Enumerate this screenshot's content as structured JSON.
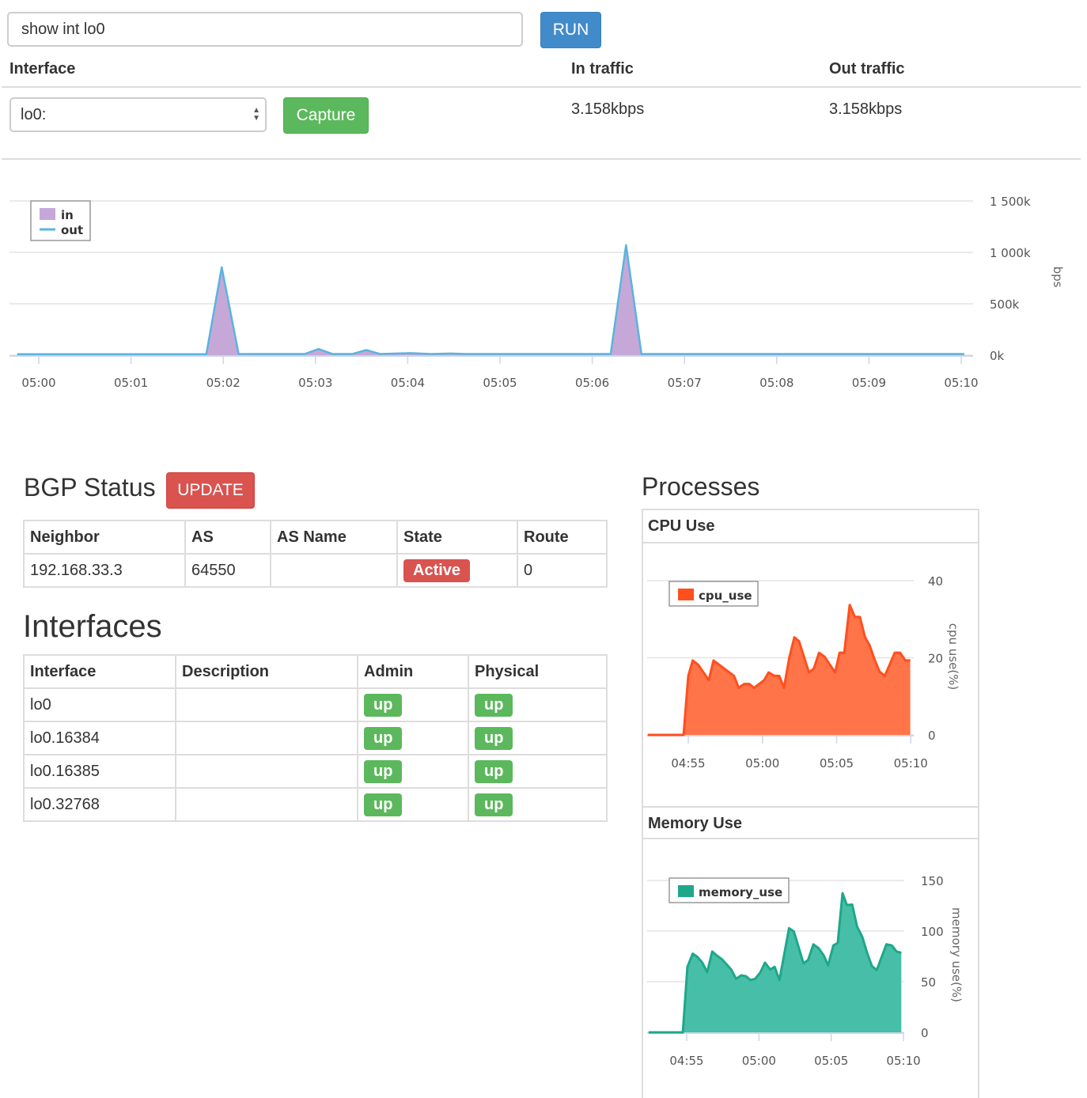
{
  "command": {
    "value": "show int lo0",
    "run_label": "RUN"
  },
  "traffic_table": {
    "headers": [
      "Interface",
      "In traffic",
      "Out traffic"
    ],
    "selected_interface": "lo0:",
    "capture_label": "Capture",
    "in_traffic": "3.158kbps",
    "out_traffic": "3.158kbps"
  },
  "bgp": {
    "title": "BGP Status",
    "update_label": "UPDATE",
    "headers": [
      "Neighbor",
      "AS",
      "AS Name",
      "State",
      "Route"
    ],
    "rows": [
      {
        "neighbor": "192.168.33.3",
        "as": "64550",
        "as_name": "",
        "state": "Active",
        "route": "0"
      }
    ]
  },
  "interfaces": {
    "title": "Interfaces",
    "headers": [
      "Interface",
      "Description",
      "Admin",
      "Physical"
    ],
    "rows": [
      {
        "name": "lo0",
        "description": "",
        "admin": "up",
        "physical": "up"
      },
      {
        "name": "lo0.16384",
        "description": "",
        "admin": "up",
        "physical": "up"
      },
      {
        "name": "lo0.16385",
        "description": "",
        "admin": "up",
        "physical": "up"
      },
      {
        "name": "lo0.32768",
        "description": "",
        "admin": "up",
        "physical": "up"
      }
    ]
  },
  "processes": {
    "title": "Processes",
    "cpu_title": "CPU Use",
    "memory_title": "Memory Use"
  },
  "colors": {
    "in": "#c5a8d8",
    "out": "#5ab4dc",
    "cpu": "#ff4f1f",
    "cpu_fill": "#ff7448",
    "memory": "#1fa78a",
    "memory_fill": "#47bfa8",
    "run": "#428bca",
    "capture": "#5cb85c",
    "danger": "#d9534f"
  },
  "chart_data": [
    {
      "type": "area",
      "ylabel": "bps",
      "ylim": [
        0,
        1500
      ],
      "yticks": [
        "0k",
        "500k",
        "1 000k",
        "1 500k"
      ],
      "yvalues": [
        0,
        500,
        1000,
        1500
      ],
      "xticks": [
        "05:00",
        "05:01",
        "05:02",
        "05:03",
        "05:04",
        "05:05",
        "05:06",
        "05:07",
        "05:08",
        "05:09",
        "05:10"
      ],
      "grid": true,
      "legend": "top-left",
      "x": [
        "04:59:46",
        "05:01:49",
        "05:01:59",
        "05:02:10",
        "05:02:53",
        "05:03:02",
        "05:03:11",
        "05:03:24",
        "05:03:33",
        "05:03:42",
        "05:04:02",
        "05:04:15",
        "05:04:28",
        "05:04:38",
        "05:06:12",
        "05:06:22",
        "05:06:32",
        "05:10:02"
      ],
      "series": [
        {
          "name": "in",
          "values": [
            8,
            8,
            850,
            10,
            10,
            55,
            10,
            10,
            45,
            10,
            18,
            10,
            15,
            10,
            10,
            1060,
            10,
            10
          ]
        },
        {
          "name": "out",
          "values": [
            10,
            10,
            855,
            12,
            12,
            60,
            12,
            12,
            50,
            12,
            20,
            12,
            16,
            12,
            12,
            1070,
            12,
            12
          ]
        }
      ]
    },
    {
      "type": "area",
      "ylabel": "cpu use(%)",
      "ylim": [
        0,
        40
      ],
      "yticks": [
        "0",
        "20",
        "40"
      ],
      "yvalues": [
        0,
        20,
        40
      ],
      "xticks": [
        "04:55",
        "05:00",
        "05:05",
        "05:10"
      ],
      "grid": true,
      "legend": "top-left",
      "x": [
        "04:52:16",
        "04:54:41",
        "04:55:00",
        "04:55:18",
        "04:55:40",
        "04:56:23",
        "04:56:42",
        "04:58:05",
        "04:58:24",
        "04:58:46",
        "04:59:07",
        "04:59:26",
        "05:00:07",
        "05:00:25",
        "05:00:49",
        "05:01:08",
        "05:01:27",
        "05:01:49",
        "05:02:09",
        "05:02:28",
        "05:03:08",
        "05:03:28",
        "05:03:49",
        "05:04:11",
        "05:04:54",
        "05:05:12",
        "05:05:31",
        "05:05:53",
        "05:06:14",
        "05:06:34",
        "05:06:55",
        "05:07:13",
        "05:07:35",
        "05:07:54",
        "05:08:15",
        "05:08:55",
        "05:09:17",
        "05:09:38",
        "05:09:58"
      ],
      "series": [
        {
          "name": "cpu_use",
          "values": [
            0,
            0,
            15.3,
            19.3,
            18.2,
            14.2,
            19.3,
            15.3,
            12.2,
            13.2,
            13.2,
            12.2,
            14.2,
            16.2,
            15.3,
            15.3,
            12.2,
            20.1,
            25.3,
            24.3,
            16.2,
            17.2,
            21.3,
            20.3,
            16.2,
            21.3,
            21.3,
            33.7,
            30.6,
            30.6,
            25.3,
            23.3,
            19.3,
            16.4,
            15.3,
            21.3,
            21.3,
            19.3,
            19.3
          ]
        }
      ]
    },
    {
      "type": "area",
      "ylabel": "memory use(%)",
      "ylim": [
        0,
        150
      ],
      "yticks": [
        "0",
        "50",
        "100",
        "150"
      ],
      "yvalues": [
        0,
        50,
        100,
        150
      ],
      "xticks": [
        "04:55",
        "05:00",
        "05:05",
        "05:10"
      ],
      "grid": true,
      "legend": "top-left",
      "x": [
        "04:52:22",
        "04:54:44",
        "04:55:03",
        "04:55:25",
        "04:55:44",
        "04:56:05",
        "04:56:25",
        "04:56:46",
        "04:57:05",
        "04:57:27",
        "04:58:05",
        "04:58:25",
        "04:58:47",
        "04:59:05",
        "04:59:25",
        "04:59:44",
        "05:00:05",
        "05:00:25",
        "05:00:47",
        "05:01:05",
        "05:01:25",
        "05:01:47",
        "05:02:05",
        "05:02:25",
        "05:03:05",
        "05:03:24",
        "05:03:46",
        "05:04:08",
        "05:04:29",
        "05:04:47",
        "05:05:09",
        "05:05:27",
        "05:05:47",
        "05:06:05",
        "05:06:27",
        "05:06:47",
        "05:07:09",
        "05:07:29",
        "05:07:49",
        "05:08:09",
        "05:08:49",
        "05:09:11",
        "05:09:31",
        "05:09:51"
      ],
      "series": [
        {
          "name": "memory_use",
          "values": [
            0,
            0,
            64.7,
            77.7,
            74.6,
            68.8,
            59.4,
            79.8,
            75.9,
            72,
            62,
            52.9,
            56.3,
            55.5,
            51.6,
            52.9,
            58.9,
            68.8,
            62,
            64.7,
            51.6,
            79.8,
            102.9,
            99.5,
            68,
            71.5,
            86.9,
            83,
            75.9,
            66.2,
            85.9,
            88.2,
            137.4,
            125.7,
            126.2,
            104.7,
            94.2,
            78.5,
            65.4,
            61.5,
            86.9,
            85.9,
            79.8,
            78.5
          ]
        }
      ]
    }
  ]
}
